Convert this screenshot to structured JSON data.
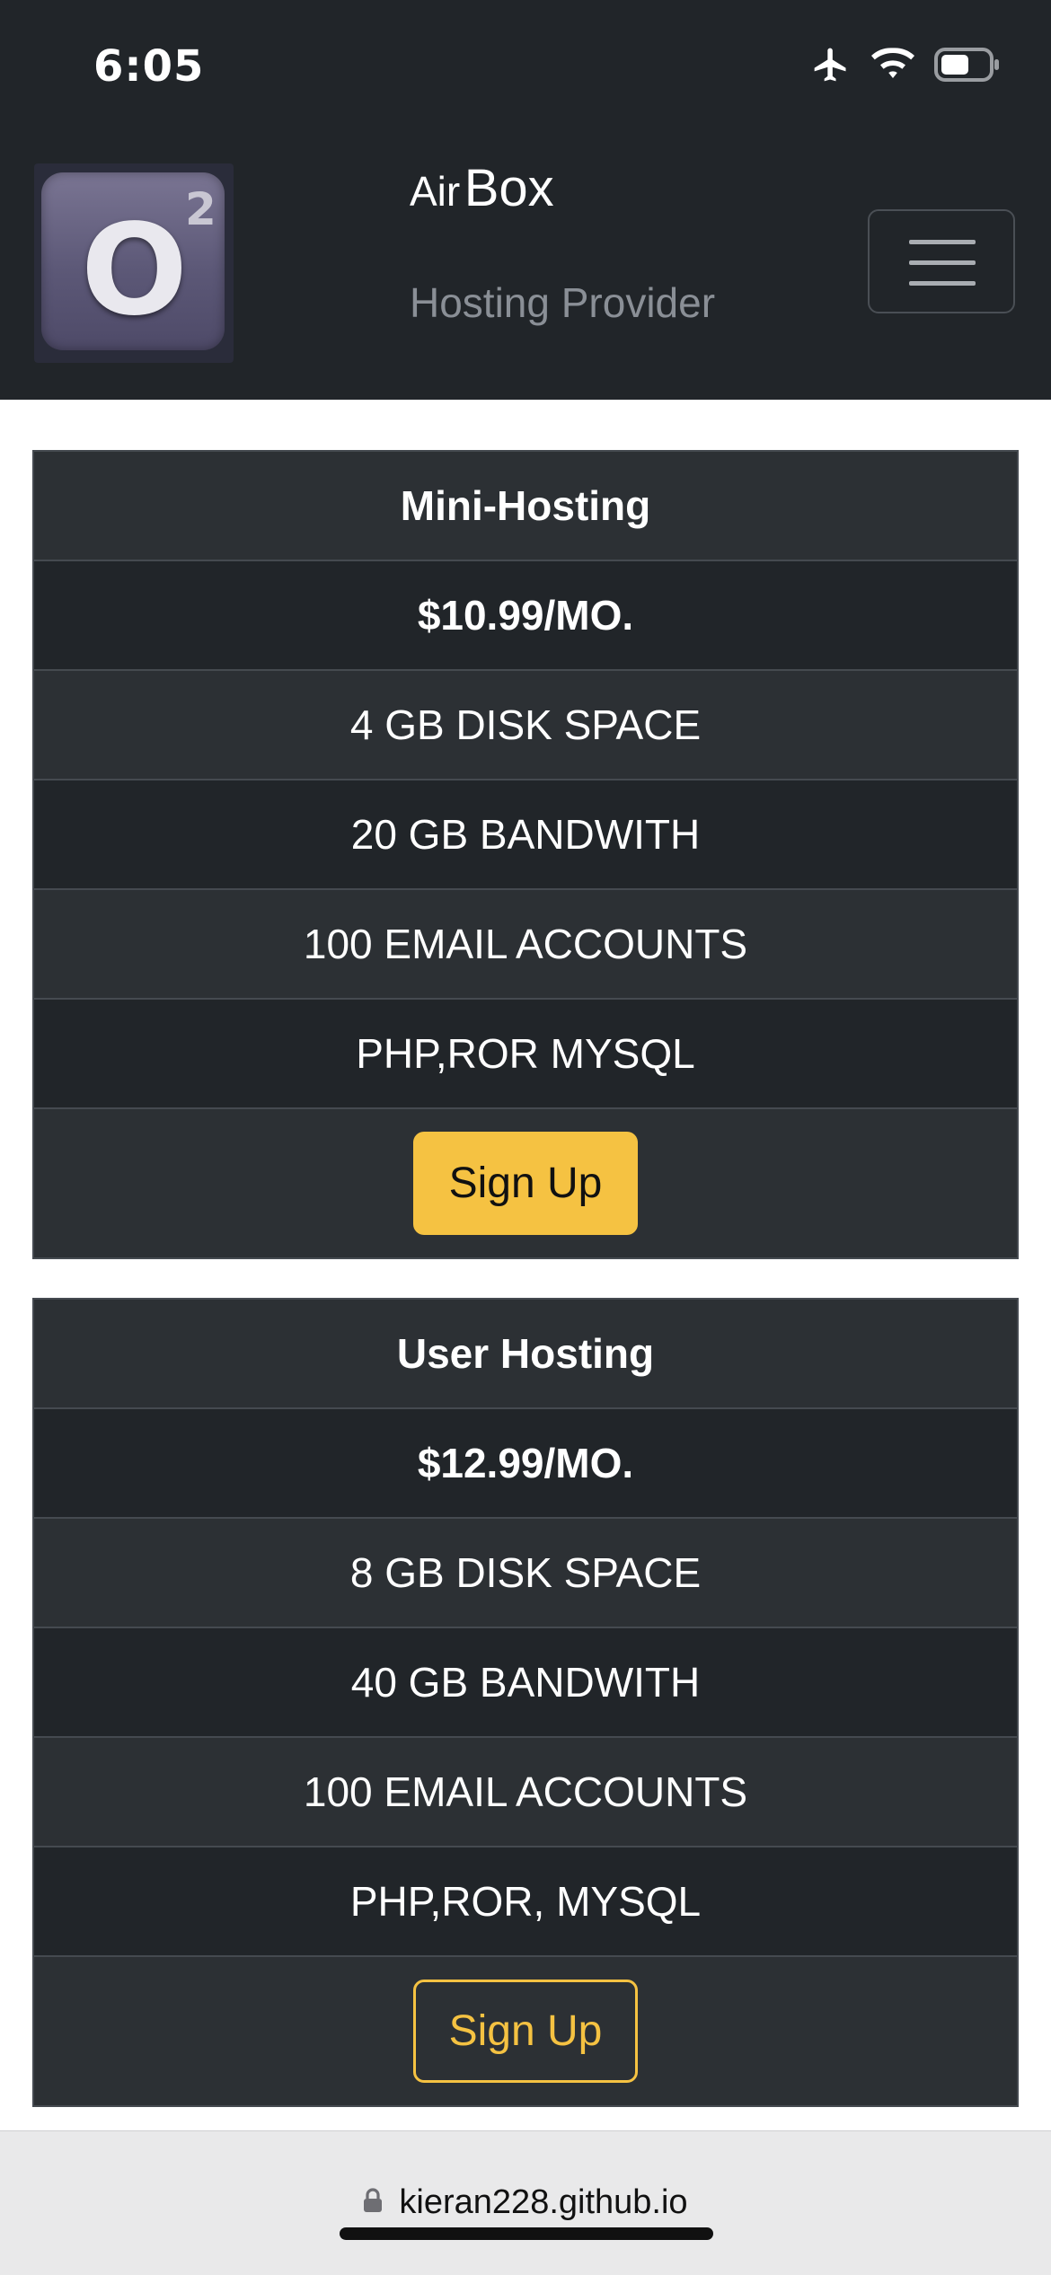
{
  "status_bar": {
    "time": "6:05",
    "icons": [
      "airplane-icon",
      "wifi-icon",
      "battery-icon"
    ]
  },
  "navbar": {
    "logo_letter": "O",
    "logo_superscript": "2",
    "brand_small": "Air",
    "brand_big": "Box",
    "tagline": "Hosting Provider",
    "menu_icon": "hamburger-icon"
  },
  "plans": [
    {
      "name": "Mini-Hosting",
      "price": "$10.99/MO.",
      "features": [
        "4 GB DISK SPACE",
        "20 GB BANDWITH",
        "100 EMAIL ACCOUNTS",
        "PHP,ROR MYSQL"
      ],
      "button_label": "Sign Up"
    },
    {
      "name": "User Hosting",
      "price": "$12.99/MO.",
      "features": [
        "8 GB DISK SPACE",
        "40 GB BANDWITH",
        "100 EMAIL ACCOUNTS",
        "PHP,ROR, MYSQL"
      ],
      "button_label": "Sign Up"
    }
  ],
  "browser": {
    "url": "kieran228.github.io",
    "lock_icon": "lock-icon"
  },
  "colors": {
    "dark_bg": "#212529",
    "striped_bg": "#2c3034",
    "accent": "#f5c242"
  }
}
